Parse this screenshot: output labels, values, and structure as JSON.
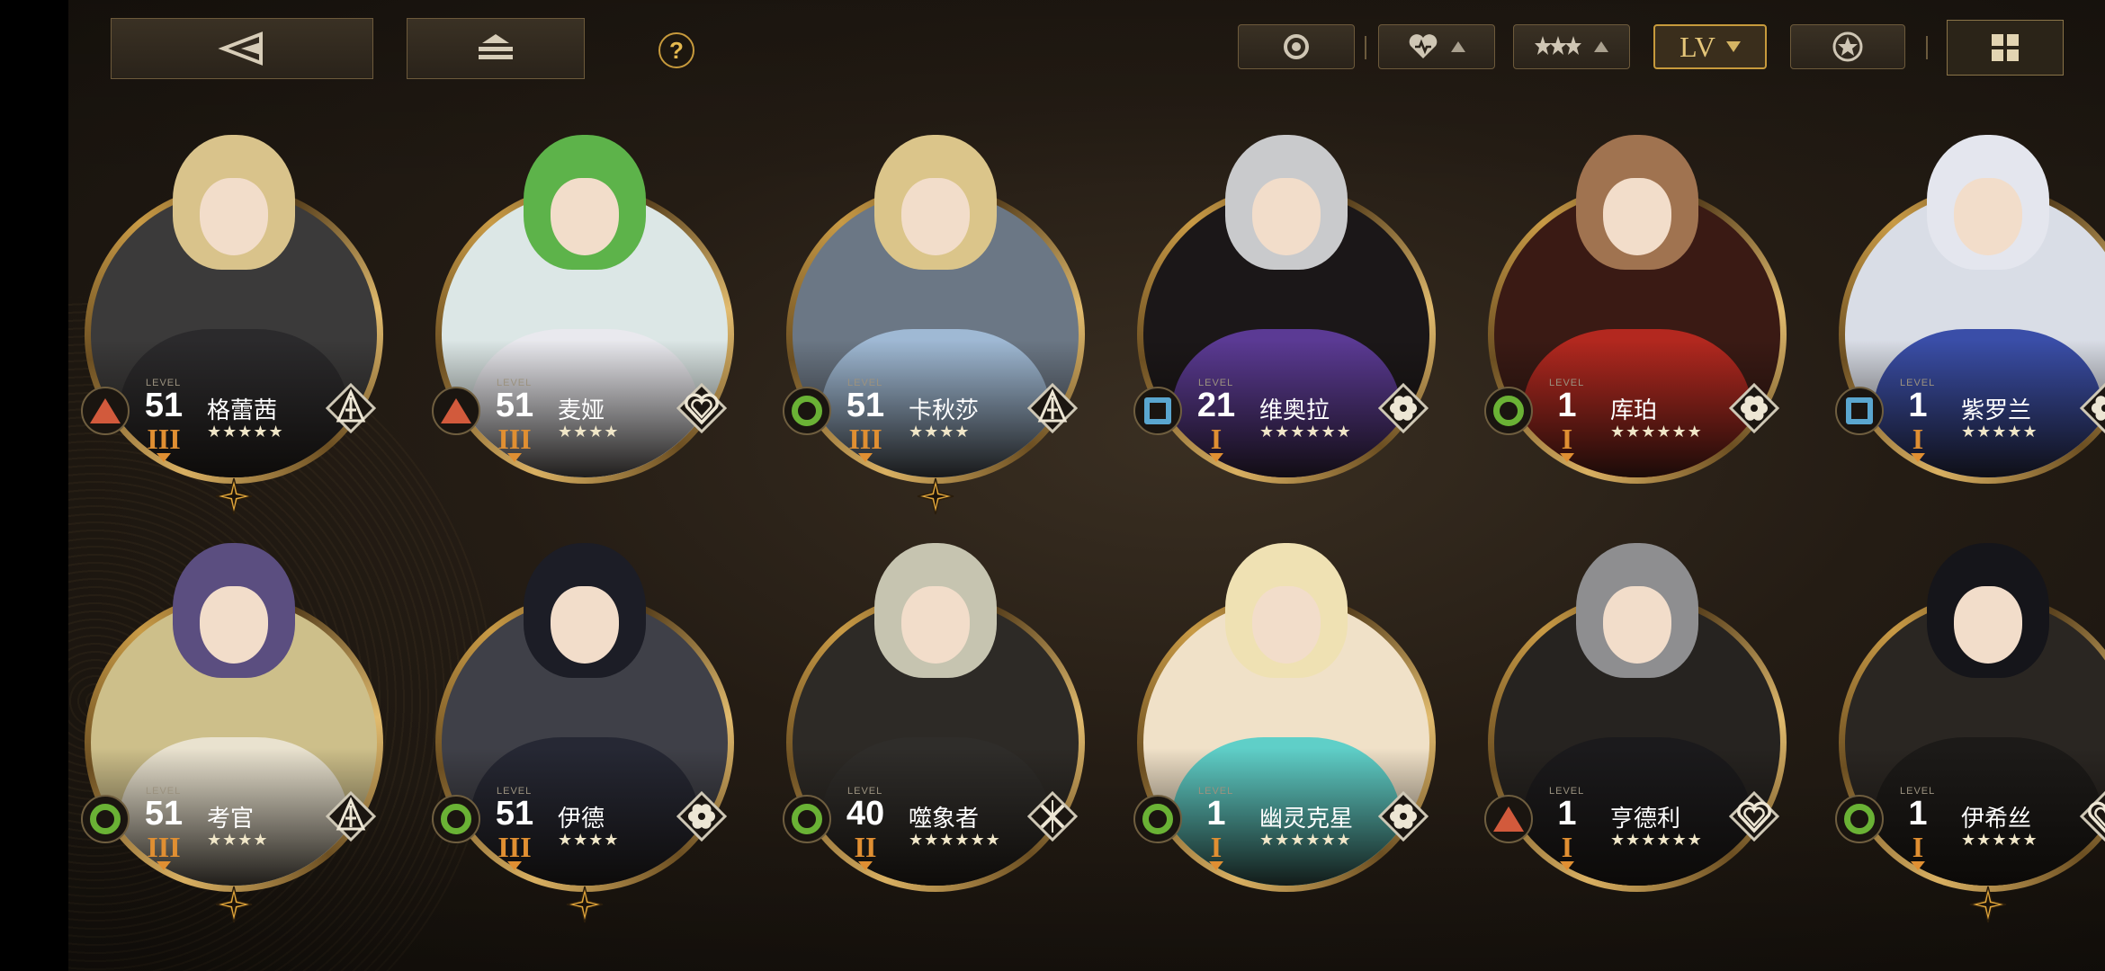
{
  "toolbar": {
    "back_icon": "back-triangle-icon",
    "layer_icon": "stack-layers-icon",
    "help_label": "?",
    "filters": [
      {
        "name": "element",
        "icon": "target-circle-icon"
      },
      {
        "name": "affinity",
        "icon": "heart-icon"
      },
      {
        "name": "rarity",
        "icon": "stars-icon"
      },
      {
        "name": "sort",
        "label": "LV",
        "active": true
      },
      {
        "name": "favorite",
        "icon": "star-badge-icon"
      }
    ],
    "view_icon": "grid-view-icon"
  },
  "level_caption": "LEVEL",
  "colors": {
    "gold": "#c79a3c",
    "element_red": "#d25a3c",
    "element_green": "#6ab235",
    "element_blue": "#5aa6cf",
    "rank_orange": "#e08f32"
  },
  "characters": [
    {
      "name": "格蕾茜",
      "level": "51",
      "rank": "III",
      "stars": "★★★★★",
      "element": "triangle",
      "class": "tower",
      "spark": true
    },
    {
      "name": "麦娅",
      "level": "51",
      "rank": "III",
      "stars": "★★★★",
      "element": "triangle",
      "class": "heart",
      "spark": false
    },
    {
      "name": "卡秋莎",
      "level": "51",
      "rank": "III",
      "stars": "★★★★",
      "element": "circle",
      "class": "tower",
      "spark": true
    },
    {
      "name": "维奥拉",
      "level": "21",
      "rank": "I",
      "stars": "★★★★★★",
      "element": "square",
      "class": "flower",
      "spark": false
    },
    {
      "name": "库珀",
      "level": "1",
      "rank": "I",
      "stars": "★★★★★★",
      "element": "circle",
      "class": "flower",
      "spark": false
    },
    {
      "name": "紫罗兰",
      "level": "1",
      "rank": "I",
      "stars": "★★★★★",
      "element": "square",
      "class": "flower",
      "spark": false
    },
    {
      "name": "考官",
      "level": "51",
      "rank": "III",
      "stars": "★★★★",
      "element": "circle",
      "class": "tower",
      "spark": true
    },
    {
      "name": "伊德",
      "level": "51",
      "rank": "III",
      "stars": "★★★★",
      "element": "circle",
      "class": "flower",
      "spark": true
    },
    {
      "name": "噬象者",
      "level": "40",
      "rank": "II",
      "stars": "★★★★★★",
      "element": "circle",
      "class": "sword",
      "spark": false
    },
    {
      "name": "幽灵克星",
      "level": "1",
      "rank": "I",
      "stars": "★★★★★★",
      "element": "circle",
      "class": "flower",
      "spark": false
    },
    {
      "name": "亨德利",
      "level": "1",
      "rank": "I",
      "stars": "★★★★★★",
      "element": "triangle",
      "class": "heart",
      "spark": false
    },
    {
      "name": "伊希丝",
      "level": "1",
      "rank": "I",
      "stars": "★★★★★",
      "element": "circle",
      "class": "heart",
      "spark": true
    }
  ]
}
